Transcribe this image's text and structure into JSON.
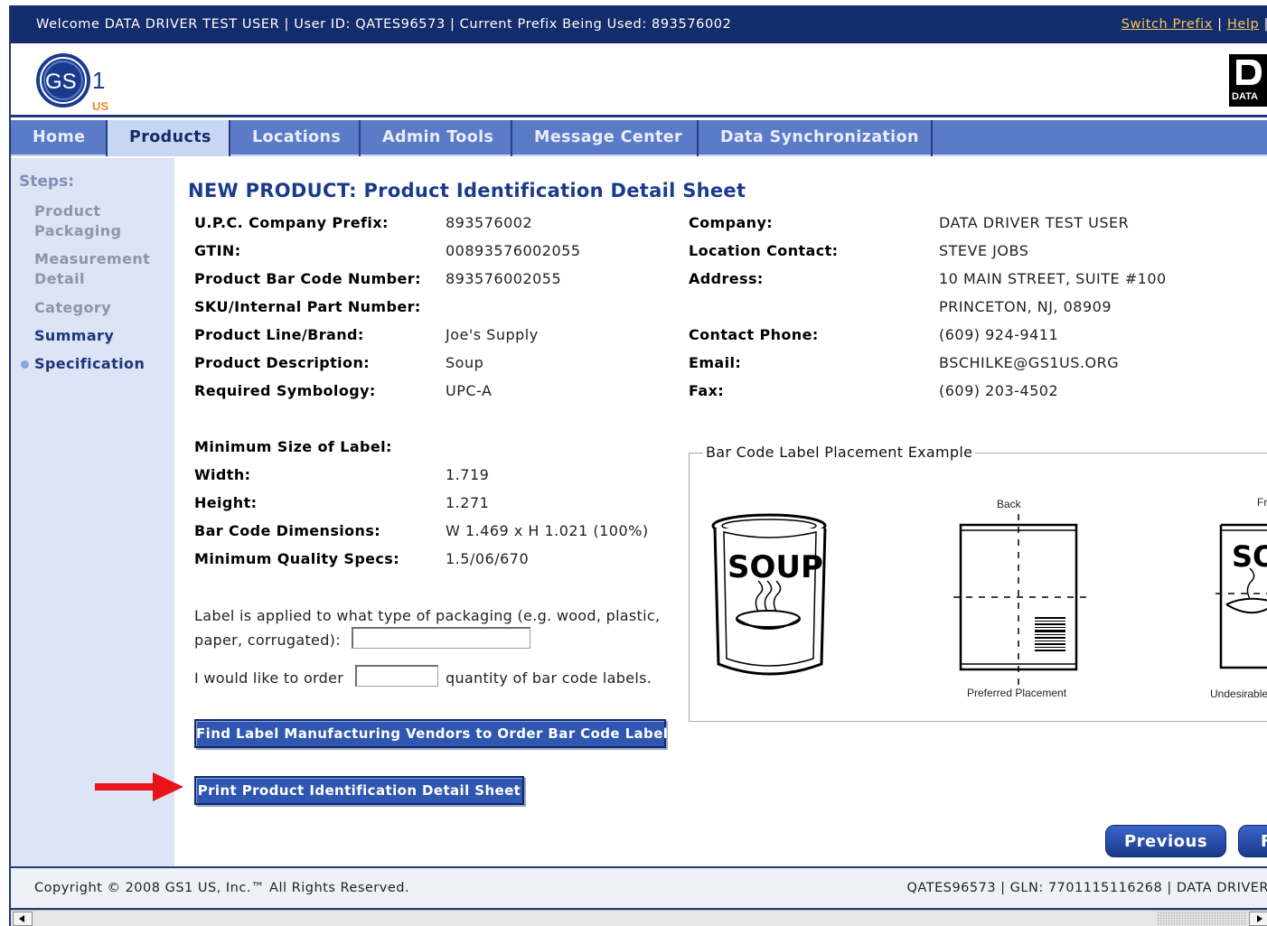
{
  "topbar": {
    "welcome": "Welcome DATA DRIVER TEST USER | User ID: QATES96573 | Current Prefix Being Used: 893576002",
    "switch_prefix": "Switch Prefix",
    "help": "Help",
    "sep": " | "
  },
  "logo": {
    "gs1_text": "GS",
    "gs1_one": "1",
    "gs1_us": "US",
    "dd_text": "DATA"
  },
  "nav": {
    "home": "Home",
    "products": "Products",
    "locations": "Locations",
    "admin_tools": "Admin Tools",
    "message_center": "Message Center",
    "data_sync": "Data Synchronization"
  },
  "sidebar": {
    "title": "Steps:",
    "steps": [
      "Product",
      "Packaging",
      "Measurement",
      "Detail",
      "Category",
      "Summary",
      "Specification"
    ]
  },
  "page": {
    "title": "NEW PRODUCT: Product Identification Detail Sheet"
  },
  "product": {
    "prefix_label": "U.P.C. Company Prefix:",
    "prefix_value": "893576002",
    "gtin_label": "GTIN:",
    "gtin_value": "00893576002055",
    "barcode_label": "Product Bar Code Number:",
    "barcode_value": "893576002055",
    "sku_label": "SKU/Internal Part Number:",
    "line_label": "Product Line/Brand:",
    "line_value": "Joe's Supply",
    "desc_label": "Product Description:",
    "desc_value": "Soup",
    "symb_label": "Required Symbology:",
    "symb_value": "UPC-A"
  },
  "company": {
    "company_label": "Company:",
    "company_value": "DATA DRIVER TEST USER",
    "contact_label": "Location Contact:",
    "contact_value": "STEVE JOBS",
    "address_label": "Address:",
    "address_line1": "10 MAIN STREET, SUITE #100",
    "address_line2": "PRINCETON, NJ, 08909",
    "phone_label": "Contact Phone:",
    "phone_value": "(609) 924-9411",
    "email_label": "Email:",
    "email_value": "BSCHILKE@GS1US.ORG",
    "fax_label": "Fax:",
    "fax_value": "(609) 203-4502"
  },
  "label_spec": {
    "min_size_label": "Minimum Size of Label:",
    "width_label": "Width:",
    "width_value": "1.719",
    "height_label": "Height:",
    "height_value": "1.271",
    "dims_label": "Bar Code Dimensions:",
    "dims_value": "W 1.469 x H 1.021 (100%)",
    "quality_label": "Minimum Quality Specs:",
    "quality_value": "1.5/06/670"
  },
  "form": {
    "packaging_line1": "Label is applied to what type of packaging (e.g. wood, plastic,",
    "packaging_line2": "paper, corrugated):",
    "order_prefix": "I would like to order",
    "order_suffix": "quantity of bar code labels.",
    "packaging_value": "",
    "order_value": ""
  },
  "buttons": {
    "find_vendors": "Find Label Manufacturing Vendors to Order Bar Code Labels",
    "print_sheet": "Print Product Identification Detail Sheet",
    "previous": "Previous",
    "next_partial": "F"
  },
  "example": {
    "legend": "Bar Code Label Placement Example",
    "soup_text": "SOUP",
    "back_caption": "Back",
    "preferred_caption": "Preferred Placement",
    "front_caption": "Fr",
    "undesirable_caption": "Undesirable",
    "soup_partial": "SOU"
  },
  "footer": {
    "copyright": "Copyright © 2008 GS1 US, Inc.™ All Rights Reserved.",
    "right": "QATES96573 | GLN: 7701115116268 | DATA DRIVER"
  },
  "colors": {
    "topbar": "#132c6b",
    "nav": "#5b7bc8",
    "nav_active": "#c7d6f2",
    "sidebar": "#dce4f5",
    "title": "#1a3a8c",
    "link": "#f2c65a",
    "annotation_arrow": "#e8141a"
  }
}
